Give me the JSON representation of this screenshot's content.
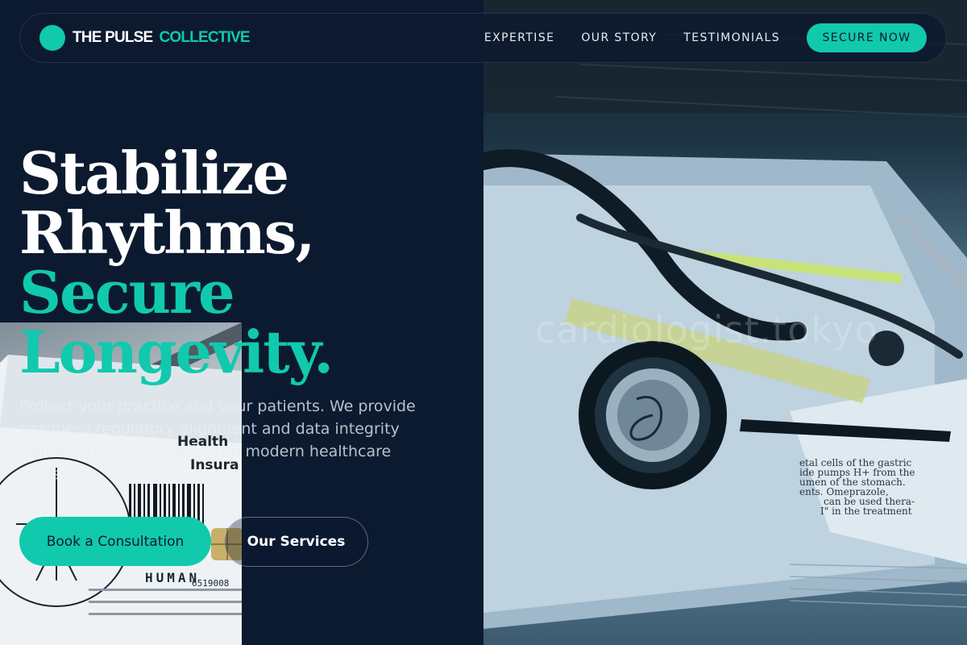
{
  "brand": {
    "name_part_1": "THE PULSE",
    "name_part_2": "COLLECTIVE",
    "logo_icon": "teal-circle-logo"
  },
  "nav": {
    "links": [
      "EXPERTISE",
      "OUR STORY",
      "TESTIMONIALS"
    ],
    "cta_label": "SECURE NOW"
  },
  "hero": {
    "headline": {
      "line_1": "Stabilize",
      "line_2": "Rhythms,",
      "line_3": "Secure",
      "line_4": "Longevity."
    },
    "lead": "Protect your practice and your patients. We provide seamless regulatory alignment and data integrity frameworks designed for the modern healthcare landscape.",
    "primary_button": "Book a Consultation",
    "secondary_button": "Our Services"
  },
  "images": {
    "hero_photo": "stethoscope-on-medical-book-photo",
    "card_photo": "health-insurance-card-photo",
    "watermark": "cardiologist.tokyo",
    "book_text": [
      "etal cells of the gastric",
      "ide pumps H+ from the",
      "umen of the stomach.",
      "ents. Omeprazole,",
      "can be used thera-",
      "I\" in the treatment"
    ],
    "card_text": [
      "Health",
      "Insura",
      "HUMAN",
      "6519008"
    ]
  },
  "colors": {
    "background": "#0c1a30",
    "accent": "#11c9ad",
    "text": "#ffffff"
  }
}
